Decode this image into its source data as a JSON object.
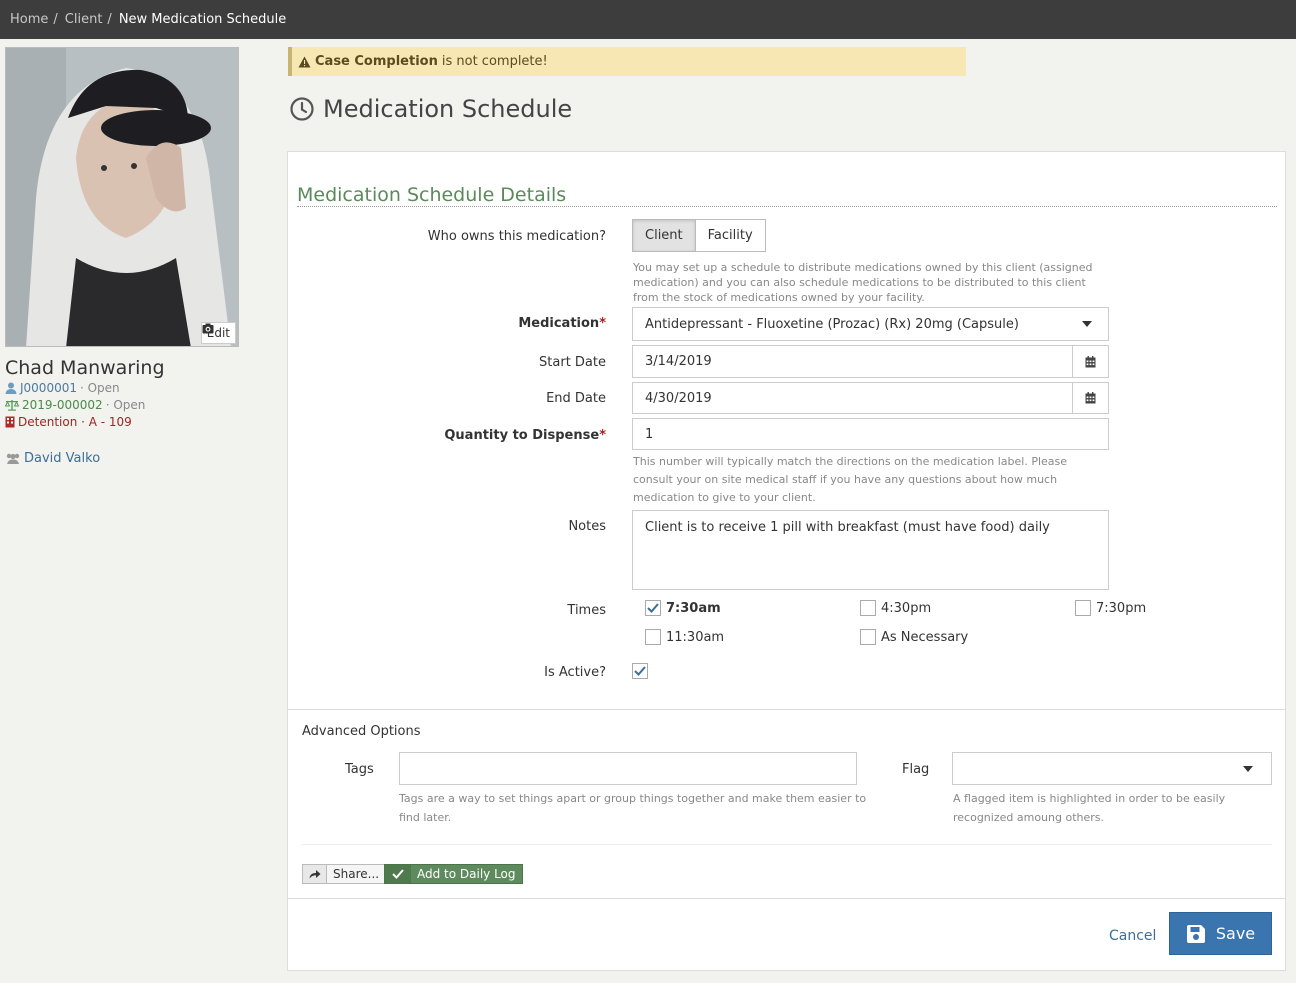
{
  "breadcrumb": {
    "home": "Home",
    "client": "Client",
    "current": "New Medication Schedule",
    "sep": "/"
  },
  "client": {
    "edit_label": "Edit",
    "name": "Chad Manwaring",
    "client_id": "J0000001",
    "client_status": "· Open",
    "case_id": "2019-000002",
    "case_status": "· Open",
    "location": "Detention · A - 109",
    "staff": "David Valko"
  },
  "alert": {
    "bold": "Case Completion",
    "rest": "is not complete!"
  },
  "page_title": "Medication Schedule",
  "form": {
    "section_title": "Medication Schedule Details",
    "owner": {
      "label": "Who owns this medication?",
      "options": [
        "Client",
        "Facility"
      ],
      "selected": "Client",
      "help": "You may set up a schedule to distribute medications owned by this client (assigned medication) and you can also schedule medications to be distributed to this client from the stock of medications owned by your facility."
    },
    "medication": {
      "label": "Medication",
      "req": "*",
      "value": "Antidepressant - Fluoxetine (Prozac) (Rx) 20mg (Capsule)"
    },
    "start_date": {
      "label": "Start Date",
      "value": "3/14/2019"
    },
    "end_date": {
      "label": "End Date",
      "value": "4/30/2019"
    },
    "quantity": {
      "label": "Quantity to Dispense",
      "req": "*",
      "value": "1",
      "help": "This number will typically match the directions on the medication label. Please consult your on site medical staff if you have any questions about how much medication to give to your client."
    },
    "notes": {
      "label": "Notes",
      "value": "Client is to receive 1 pill with breakfast (must have food) daily"
    },
    "times": {
      "label": "Times",
      "options": [
        {
          "label": "7:30am",
          "checked": true
        },
        {
          "label": "4:30pm",
          "checked": false
        },
        {
          "label": "7:30pm",
          "checked": false
        },
        {
          "label": "11:30am",
          "checked": false
        },
        {
          "label": "As Necessary",
          "checked": false
        }
      ]
    },
    "is_active": {
      "label": "Is Active?",
      "checked": true
    }
  },
  "advanced": {
    "title": "Advanced Options",
    "tags": {
      "label": "Tags",
      "value": "",
      "help": "Tags are a way to set things apart or group things together and make them easier to find later."
    },
    "flag": {
      "label": "Flag",
      "value": "",
      "help": "A flagged item is highlighted in order to be easily recognized amoung others."
    }
  },
  "actions": {
    "share": "Share...",
    "daily_log": "Add to Daily Log",
    "cancel": "Cancel",
    "save": "Save"
  },
  "colors": {
    "accent_green": "#5a8a5a",
    "primary_blue": "#3a75b0",
    "alert_bg": "#f6e7b3",
    "required_red": "#a32323"
  }
}
